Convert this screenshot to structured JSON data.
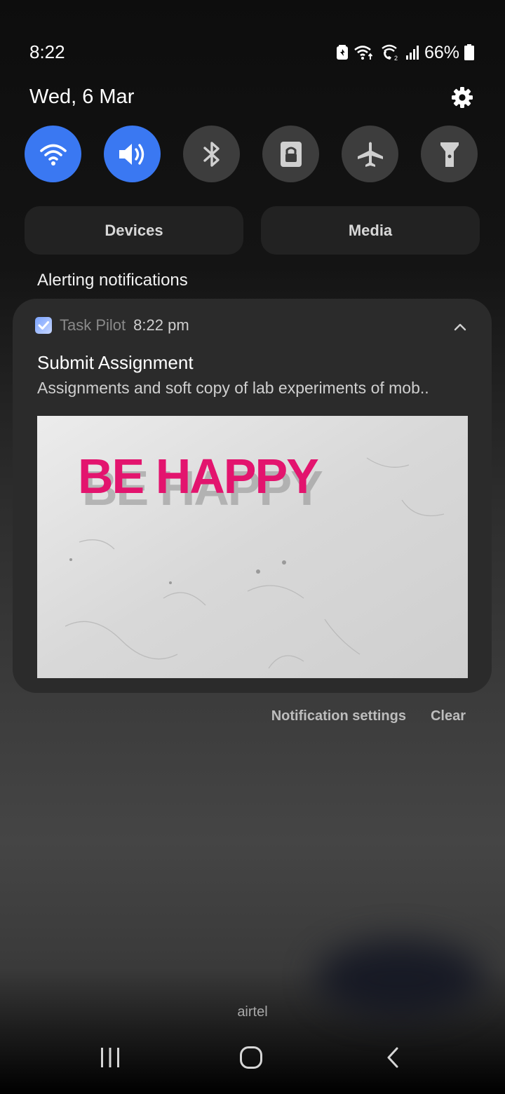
{
  "status_bar": {
    "time": "8:22",
    "battery_percent": "66%",
    "icons": [
      "battery-saver-icon",
      "wifi-icon",
      "wifi-calling-icon",
      "signal-icon",
      "battery-icon"
    ]
  },
  "header": {
    "date": "Wed, 6 Mar",
    "settings_icon": "gear-icon"
  },
  "quick_toggles": [
    {
      "icon": "wifi-icon",
      "active": true
    },
    {
      "icon": "volume-icon",
      "active": true
    },
    {
      "icon": "bluetooth-icon",
      "active": false
    },
    {
      "icon": "screen-lock-icon",
      "active": false
    },
    {
      "icon": "airplane-icon",
      "active": false
    },
    {
      "icon": "flashlight-icon",
      "active": false
    }
  ],
  "panel_buttons": {
    "devices": "Devices",
    "media": "Media"
  },
  "section_title": "Alerting notifications",
  "notification": {
    "app_name": "Task Pilot",
    "time": "8:22 pm",
    "title": "Submit Assignment",
    "text": "Assignments and soft copy of lab experiments of mob..",
    "image_text": "BE HAPPY"
  },
  "notification_actions": {
    "settings": "Notification settings",
    "clear": "Clear"
  },
  "carrier": "airtel",
  "colors": {
    "accent": "#3a78f2",
    "toggle_off": "#3d3d3d",
    "card": "#2b2b2b",
    "image_letters": "#e3146e"
  },
  "nav_bar": [
    "recents-icon",
    "home-icon",
    "back-icon"
  ]
}
